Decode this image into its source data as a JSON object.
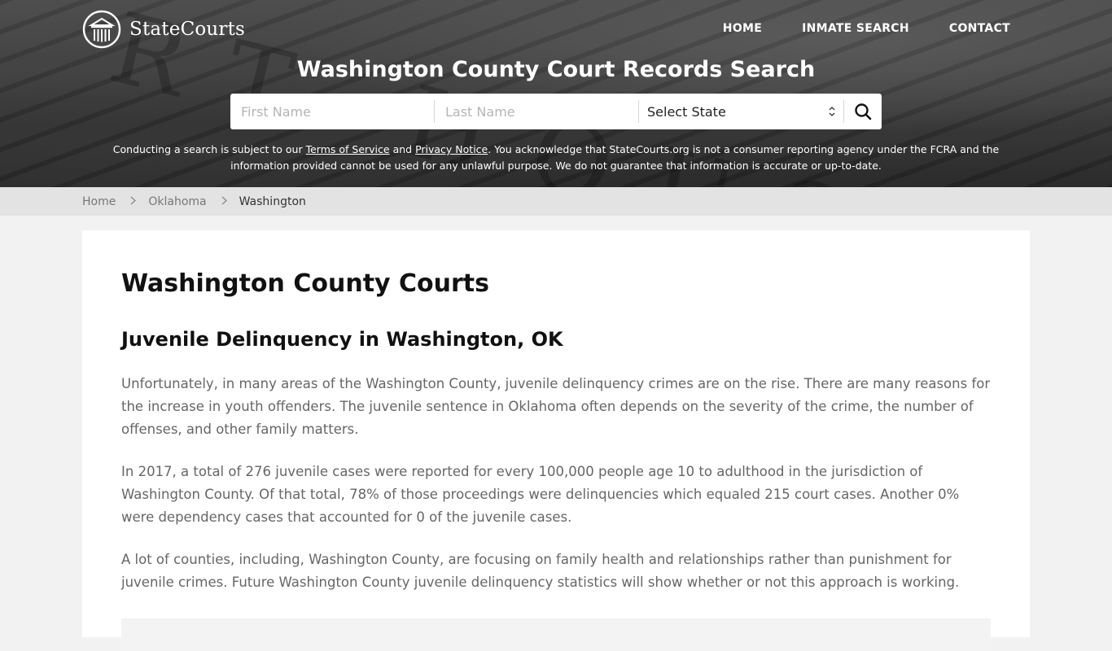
{
  "site": {
    "brand": "StateCourts",
    "logo_icon": "courthouse-columns-icon"
  },
  "nav": {
    "items": [
      {
        "label": "HOME"
      },
      {
        "label": "INMATE SEARCH"
      },
      {
        "label": "CONTACT"
      }
    ]
  },
  "hero": {
    "title": "Washington County Court Records Search",
    "search": {
      "first_name_placeholder": "First Name",
      "last_name_placeholder": "Last Name",
      "first_name_value": "",
      "last_name_value": "",
      "state_selected": "Select State",
      "search_icon": "search-icon"
    },
    "disclaimer": {
      "prefix": "Conducting a search is subject to our ",
      "terms_link": "Terms of Service",
      "and": " and ",
      "privacy_link": "Privacy Notice",
      "suffix": ". You acknowledge that StateCourts.org is not a consumer reporting agency under the FCRA and the information provided cannot be used for any unlawful purpose. We do not guarantee that information is accurate or up-to-date."
    }
  },
  "breadcrumb": {
    "items": [
      {
        "label": "Home"
      },
      {
        "label": "Oklahoma"
      }
    ],
    "current": "Washington",
    "separator_icon": "chevron-right-icon"
  },
  "main": {
    "page_title": "Washington County Courts",
    "section_title": "Juvenile Delinquency in Washington, OK",
    "paragraphs": [
      "Unfortunately, in many areas of the Washington County, juvenile delinquency crimes are on the rise. There are many reasons for the increase in youth offenders. The juvenile sentence in Oklahoma often depends on the severity of the crime, the number of offenses, and other family matters.",
      "In 2017, a total of 276 juvenile cases were reported for every 100,000 people age 10 to adulthood in the jurisdiction of Washington County. Of that total, 78% of those proceedings were delinquencies which equaled 215 court cases. Another 0% were dependency cases that accounted for 0 of the juvenile cases.",
      "A lot of counties, including, Washington County, are focusing on family health and relationships rather than punishment for juvenile crimes. Future Washington County juvenile delinquency statistics will show whether or not this approach is working."
    ]
  },
  "colors": {
    "breadcrumb_bg": "#e3e3e3",
    "page_bg": "#f2f2f2",
    "card_bg": "#ffffff",
    "body_text": "#666666",
    "heading_text": "#111111"
  }
}
